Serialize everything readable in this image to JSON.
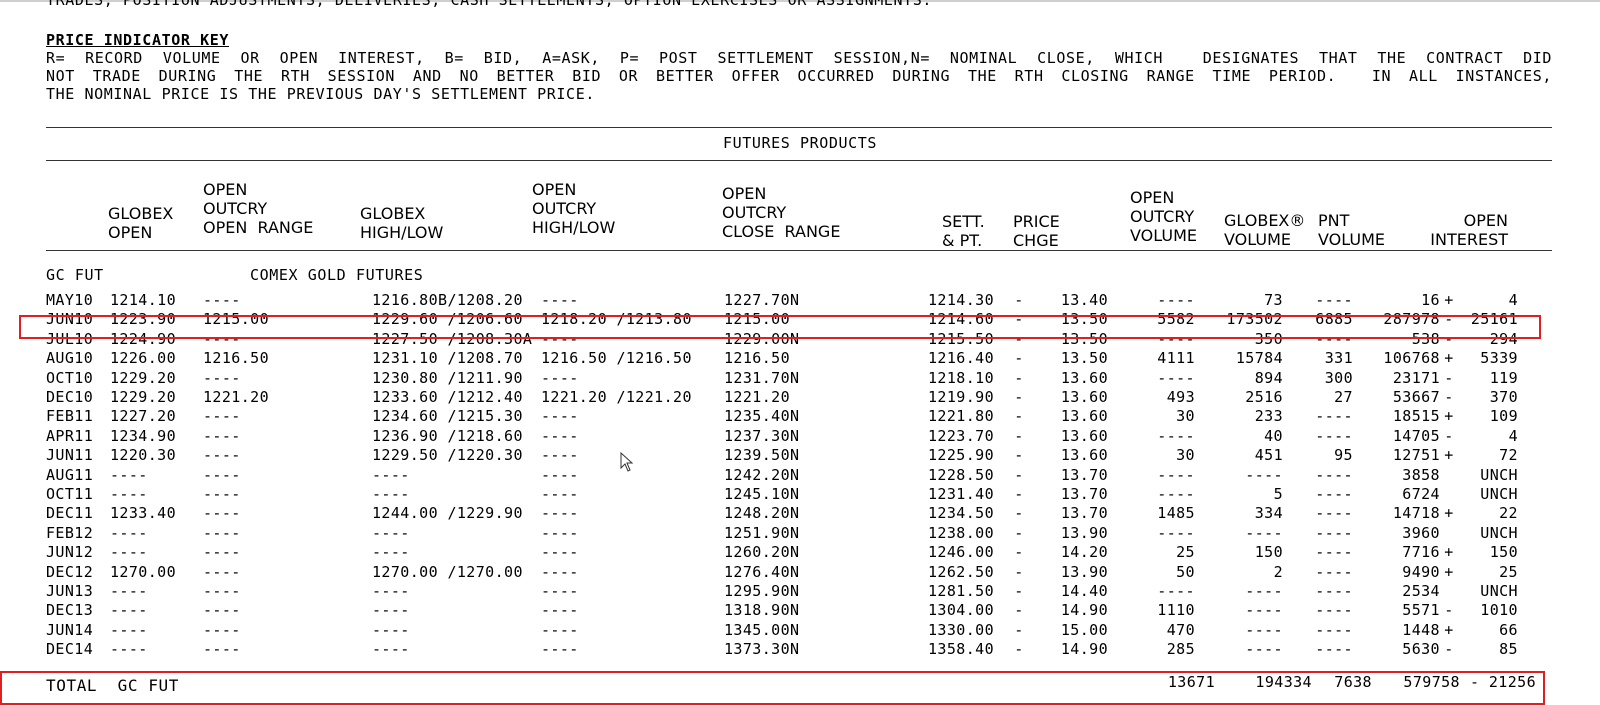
{
  "top_text": "TRADES, POSITION ADJUSTMENTS, DELIVERIES, CASH SETTLEMENTS, OPTION EXERCISES OR ASSIGNMENTS.",
  "key": {
    "heading": "PRICE INDICATOR KEY",
    "lines": [
      "R= RECORD VOLUME OR OPEN INTEREST, B= BID, A=ASK, P= POST SETTLEMENT SESSION,N= NOMINAL CLOSE, WHICH  DESIGNATES THAT THE CONTRACT DID",
      "NOT TRADE DURING THE RTH SESSION AND NO BETTER BID OR BETTER OFFER OCCURRED DURING THE RTH CLOSING RANGE TIME PERIOD.  IN ALL INSTANCES,",
      "THE NOMINAL PRICE IS THE PREVIOUS DAY'S SETTLEMENT PRICE."
    ]
  },
  "section_title": "FUTURES PRODUCTS",
  "headers": {
    "globex_open": [
      "GLOBEX",
      "OPEN"
    ],
    "oo_open_range": [
      "OPEN",
      "OUTCRY",
      "OPEN  RANGE"
    ],
    "globex_hl": [
      "GLOBEX",
      "HIGH/LOW"
    ],
    "oo_hl": [
      "OPEN",
      "OUTCRY",
      "HIGH/LOW"
    ],
    "oo_close": [
      "OPEN",
      "OUTCRY",
      "CLOSE  RANGE"
    ],
    "sett": [
      "SETT.",
      "& PT."
    ],
    "price_chge": [
      "PRICE",
      "CHGE"
    ],
    "oo_volume": [
      "OPEN",
      "OUTCRY",
      "VOLUME"
    ],
    "globex_volume": [
      "GLOBEX®",
      "VOLUME"
    ],
    "pnt_volume": [
      "PNT",
      "VOLUME"
    ],
    "open_interest": [
      "OPEN",
      "INTEREST"
    ]
  },
  "product": {
    "code": "GC FUT",
    "name": "COMEX GOLD FUTURES"
  },
  "rows": [
    [
      "MAY10",
      "1214.10",
      "----",
      "1216.80B/1208.20",
      "----",
      "1227.70N",
      "1214.30",
      "-",
      "13.40",
      "----",
      "73",
      "----",
      "16",
      "+",
      "4"
    ],
    [
      "JUN10",
      "1223.90",
      "1215.00",
      "1229.60 /1206.60",
      "1218.20 /1213.80",
      "1215.00",
      "1214.60",
      "-",
      "13.50",
      "5582",
      "173502",
      "6885",
      "287978",
      "-",
      "25161"
    ],
    [
      "JUL10",
      "1224.90",
      "----",
      "1227.50 /1208.30A",
      "----",
      "1229.00N",
      "1215.50",
      "-",
      "13.50",
      "----",
      "350",
      "----",
      "538",
      "-",
      "294"
    ],
    [
      "AUG10",
      "1226.00",
      "1216.50",
      "1231.10 /1208.70",
      "1216.50 /1216.50",
      "1216.50",
      "1216.40",
      "-",
      "13.50",
      "4111",
      "15784",
      "331",
      "106768",
      "+",
      "5339"
    ],
    [
      "OCT10",
      "1229.20",
      "----",
      "1230.80 /1211.90",
      "----",
      "1231.70N",
      "1218.10",
      "-",
      "13.60",
      "----",
      "894",
      "300",
      "23171",
      "-",
      "119"
    ],
    [
      "DEC10",
      "1229.20",
      "1221.20",
      "1233.60 /1212.40",
      "1221.20 /1221.20",
      "1221.20",
      "1219.90",
      "-",
      "13.60",
      "493",
      "2516",
      "27",
      "53667",
      "-",
      "370"
    ],
    [
      "FEB11",
      "1227.20",
      "----",
      "1234.60 /1215.30",
      "----",
      "1235.40N",
      "1221.80",
      "-",
      "13.60",
      "30",
      "233",
      "----",
      "18515",
      "+",
      "109"
    ],
    [
      "APR11",
      "1234.90",
      "----",
      "1236.90 /1218.60",
      "----",
      "1237.30N",
      "1223.70",
      "-",
      "13.60",
      "----",
      "40",
      "----",
      "14705",
      "-",
      "4"
    ],
    [
      "JUN11",
      "1220.30",
      "----",
      "1229.50 /1220.30",
      "----",
      "1239.50N",
      "1225.90",
      "-",
      "13.60",
      "30",
      "451",
      "95",
      "12751",
      "+",
      "72"
    ],
    [
      "AUG11",
      "----",
      "----",
      "----",
      "----",
      "1242.20N",
      "1228.50",
      "-",
      "13.70",
      "----",
      "----",
      "----",
      "3858",
      "",
      "UNCH"
    ],
    [
      "OCT11",
      "----",
      "----",
      "----",
      "----",
      "1245.10N",
      "1231.40",
      "-",
      "13.70",
      "----",
      "5",
      "----",
      "6724",
      "",
      "UNCH"
    ],
    [
      "DEC11",
      "1233.40",
      "----",
      "1244.00 /1229.90",
      "----",
      "1248.20N",
      "1234.50",
      "-",
      "13.70",
      "1485",
      "334",
      "----",
      "14718",
      "+",
      "22"
    ],
    [
      "FEB12",
      "----",
      "----",
      "----",
      "----",
      "1251.90N",
      "1238.00",
      "-",
      "13.90",
      "----",
      "----",
      "----",
      "3960",
      "",
      "UNCH"
    ],
    [
      "JUN12",
      "----",
      "----",
      "----",
      "----",
      "1260.20N",
      "1246.00",
      "-",
      "14.20",
      "25",
      "150",
      "----",
      "7716",
      "+",
      "150"
    ],
    [
      "DEC12",
      "1270.00",
      "----",
      "1270.00 /1270.00",
      "----",
      "1276.40N",
      "1262.50",
      "-",
      "13.90",
      "50",
      "2",
      "----",
      "9490",
      "+",
      "25"
    ],
    [
      "JUN13",
      "----",
      "----",
      "----",
      "----",
      "1295.90N",
      "1281.50",
      "-",
      "14.40",
      "----",
      "----",
      "----",
      "2534",
      "",
      "UNCH"
    ],
    [
      "DEC13",
      "----",
      "----",
      "----",
      "----",
      "1318.90N",
      "1304.00",
      "-",
      "14.90",
      "1110",
      "----",
      "----",
      "5571",
      "-",
      "1010"
    ],
    [
      "JUN14",
      "----",
      "----",
      "----",
      "----",
      "1345.00N",
      "1330.00",
      "-",
      "15.00",
      "470",
      "----",
      "----",
      "1448",
      "+",
      "66"
    ],
    [
      "DEC14",
      "----",
      "----",
      "----",
      "----",
      "1373.30N",
      "1358.40",
      "-",
      "14.90",
      "285",
      "----",
      "----",
      "5630",
      "-",
      "85"
    ]
  ],
  "total": {
    "label": "TOTAL  GC FUT",
    "oo_volume": "13671",
    "globex_volume": "194334",
    "pnt_volume": "7638",
    "open_interest": "579758",
    "oi_change": "- 21256"
  },
  "highlight_color": "#e02020"
}
